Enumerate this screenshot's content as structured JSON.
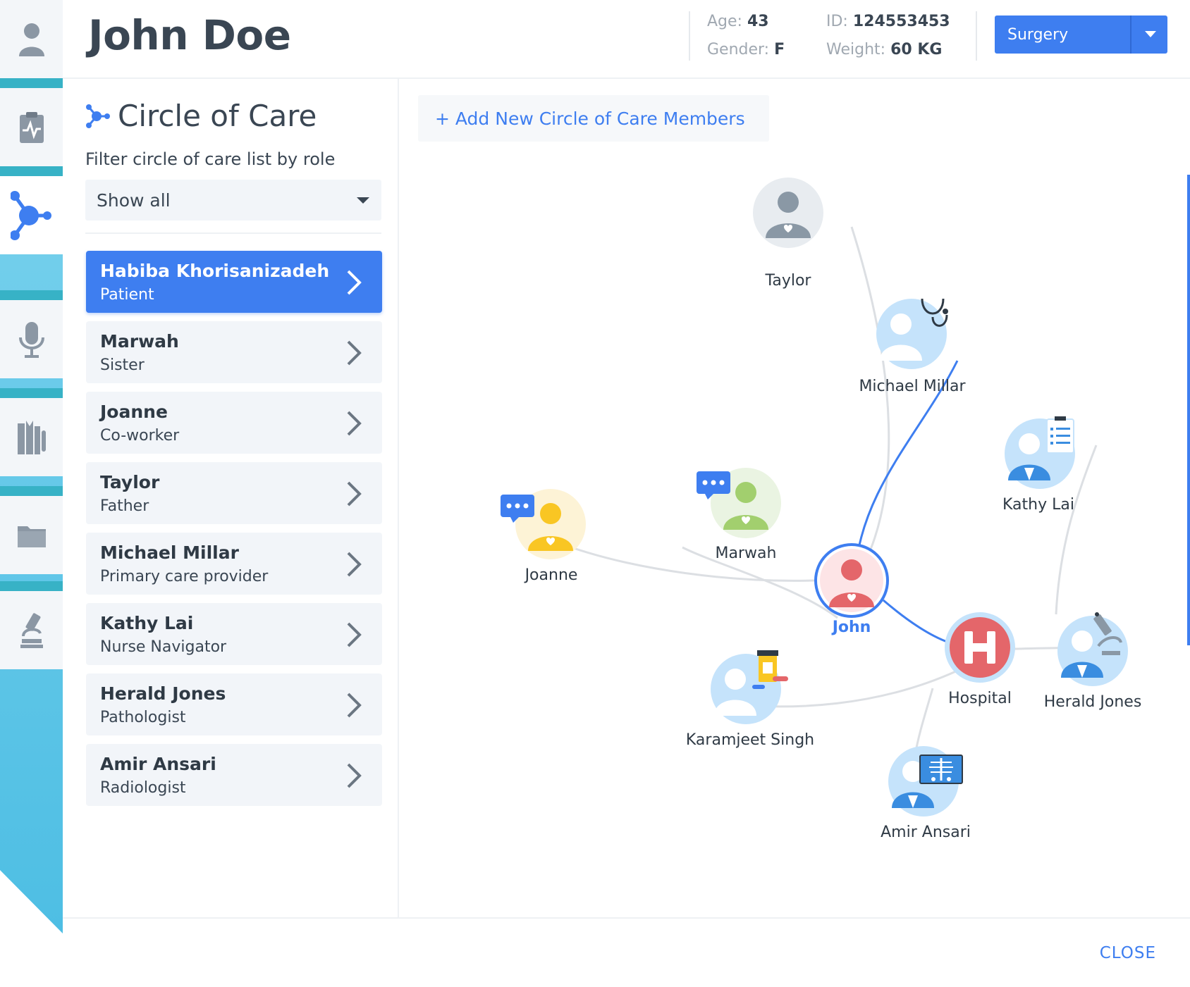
{
  "header": {
    "patient_name": "John Doe",
    "age_label": "Age:",
    "age_value": "43",
    "gender_label": "Gender:",
    "gender_value": "F",
    "id_label": "ID:",
    "id_value": "124553453",
    "weight_label": "Weight:",
    "weight_value": "60 KG",
    "department": "Surgery"
  },
  "sidebar": {
    "items": [
      {
        "icon": "user-icon"
      },
      {
        "icon": "clipboard-pulse-icon"
      },
      {
        "icon": "network-icon",
        "active": true
      },
      {
        "icon": "microphone-icon"
      },
      {
        "icon": "library-icon"
      },
      {
        "icon": "folder-icon"
      },
      {
        "icon": "microscope-icon"
      }
    ]
  },
  "panel": {
    "title": "Circle of Care",
    "filter_label": "Filter circle of care list by role",
    "filter_value": "Show all",
    "members": [
      {
        "name": "Habiba Khorisanizadeh",
        "role": "Patient",
        "selected": true
      },
      {
        "name": "Marwah",
        "role": "Sister"
      },
      {
        "name": "Joanne",
        "role": "Co-worker"
      },
      {
        "name": "Taylor",
        "role": "Father"
      },
      {
        "name": "Michael Millar",
        "role": "Primary care provider"
      },
      {
        "name": "Kathy Lai",
        "role": "Nurse Navigator"
      },
      {
        "name": "Herald Jones",
        "role": "Pathologist"
      },
      {
        "name": "Amir Ansari",
        "role": "Radiologist"
      }
    ]
  },
  "graph": {
    "add_button": "+ Add New Circle of Care Members",
    "nodes": {
      "taylor": "Taylor",
      "michael": "Michael Millar",
      "kathy": "Kathy Lai",
      "marwah": "Marwah",
      "joanne": "Joanne",
      "john": "John",
      "hospital": "Hospital",
      "herald": "Herald Jones",
      "karamjeet": "Karamjeet Singh",
      "amir": "Amir Ansari"
    },
    "colors": {
      "accent": "#3e7ef0",
      "family_yellow": "#f9c623",
      "family_green": "#a2cf6e",
      "family_gray": "#8a98a5",
      "patient_red": "#e4666a",
      "provider_blue": "#3a8de0"
    }
  },
  "footer": {
    "close_label": "CLOSE"
  }
}
